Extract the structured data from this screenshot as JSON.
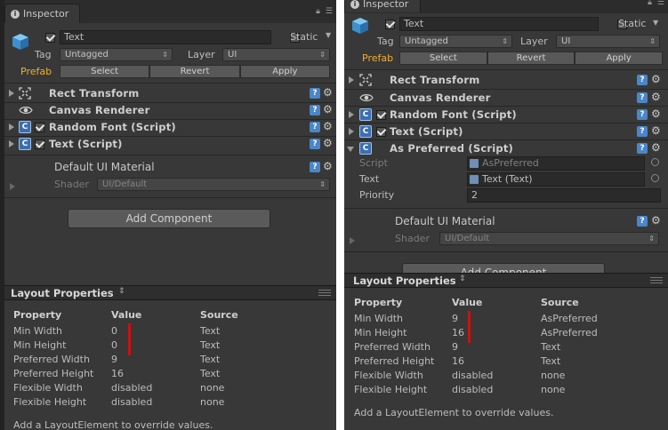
{
  "left": {
    "tab": "Inspector",
    "object_name": "Text",
    "static_label": "Static",
    "tag_label": "Tag",
    "tag_value": "Untagged",
    "layer_label": "Layer",
    "layer_value": "UI",
    "prefab_label": "Prefab",
    "prefab_buttons": [
      "Select",
      "Revert",
      "Apply"
    ],
    "components": [
      {
        "name": "Rect Transform",
        "icon": "rect-transform-icon",
        "checkbox": false
      },
      {
        "name": "Canvas Renderer",
        "icon": "eye-icon",
        "checkbox": false
      },
      {
        "name": "Random Font (Script)",
        "icon": "script-icon",
        "checkbox": true
      },
      {
        "name": "Text (Script)",
        "icon": "script-icon",
        "checkbox": true
      }
    ],
    "material_name": "Default UI Material",
    "shader_label": "Shader",
    "shader_value": "UI/Default",
    "add_component": "Add Component",
    "layout_header": "Layout Properties",
    "table_headers": [
      "Property",
      "Value",
      "Source"
    ],
    "rows": [
      [
        "Min Width",
        "0",
        "Text"
      ],
      [
        "Min Height",
        "0",
        "Text"
      ],
      [
        "Preferred Width",
        "9",
        "Text"
      ],
      [
        "Preferred Height",
        "16",
        "Text"
      ],
      [
        "Flexible Width",
        "disabled",
        "none"
      ],
      [
        "Flexible Height",
        "disabled",
        "none"
      ]
    ],
    "note": "Add a LayoutElement to override values."
  },
  "right": {
    "tab": "Inspector",
    "object_name": "Text",
    "static_label": "Static",
    "tag_label": "Tag",
    "tag_value": "Untagged",
    "layer_label": "Layer",
    "layer_value": "UI",
    "prefab_label": "Prefab",
    "prefab_buttons": [
      "Select",
      "Revert",
      "Apply"
    ],
    "components": [
      {
        "name": "Rect Transform",
        "icon": "rect-transform-icon",
        "checkbox": false
      },
      {
        "name": "Canvas Renderer",
        "icon": "eye-icon",
        "checkbox": false
      },
      {
        "name": "Random Font (Script)",
        "icon": "script-icon",
        "checkbox": true
      },
      {
        "name": "Text (Script)",
        "icon": "script-icon",
        "checkbox": true
      },
      {
        "name": "As Preferred (Script)",
        "icon": "script-icon",
        "checkbox": false,
        "expanded": true
      }
    ],
    "as_preferred": {
      "script_label": "Script",
      "script_value": "AsPreferred",
      "text_label": "Text",
      "text_value": "Text (Text)",
      "priority_label": "Priority",
      "priority_value": "2"
    },
    "material_name": "Default UI Material",
    "shader_label": "Shader",
    "shader_value": "UI/Default",
    "add_component": "Add Component",
    "layout_header": "Layout Properties",
    "table_headers": [
      "Property",
      "Value",
      "Source"
    ],
    "rows": [
      [
        "Min Width",
        "9",
        "AsPreferred"
      ],
      [
        "Min Height",
        "16",
        "AsPreferred"
      ],
      [
        "Preferred Width",
        "9",
        "Text"
      ],
      [
        "Preferred Height",
        "16",
        "Text"
      ],
      [
        "Flexible Width",
        "disabled",
        "none"
      ],
      [
        "Flexible Height",
        "disabled",
        "none"
      ]
    ],
    "note": "Add a LayoutElement to override values."
  },
  "colors": {
    "prefab": "#f0b030",
    "help_badge": "#4a86c8",
    "highlight_bar": "#cc1010",
    "panel_bg": "#383838"
  }
}
